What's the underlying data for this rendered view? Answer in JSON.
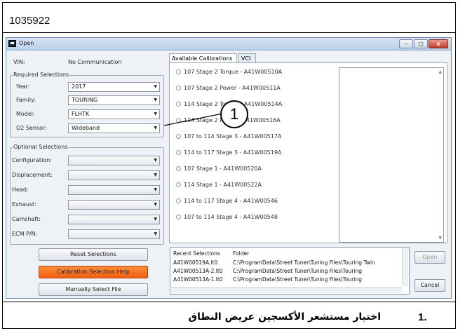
{
  "document": {
    "id": "1035922",
    "callout_number": "1",
    "caption_number": "1.",
    "caption_text": "اختيار مستشعر الأكسجين عريض النطاق"
  },
  "window": {
    "title": "Open",
    "controls": {
      "minimize": "–",
      "maximize": "□",
      "close": "x"
    }
  },
  "vin": {
    "label": "VIN:",
    "value": "No Communication"
  },
  "required_selections": {
    "caption": "Required Selections",
    "fields": [
      {
        "label": "Year:",
        "value": "2017"
      },
      {
        "label": "Family:",
        "value": "TOURING"
      },
      {
        "label": "Model:",
        "value": "FLHTK"
      },
      {
        "label": "O2 Sensor:",
        "value": "Wideband"
      }
    ]
  },
  "optional_selections": {
    "caption": "Optional Selections",
    "fields": [
      {
        "label": "Configuration:",
        "value": ""
      },
      {
        "label": "Displacement:",
        "value": ""
      },
      {
        "label": "Head:",
        "value": ""
      },
      {
        "label": "Exhaust:",
        "value": ""
      },
      {
        "label": "Camshaft:",
        "value": ""
      },
      {
        "label": "ECM P/N:",
        "value": ""
      }
    ]
  },
  "buttons": {
    "reset": "Reset Selections",
    "help": "Calibration Selection Help",
    "manual": "Manually Select File",
    "open": "Open",
    "cancel": "Cancel"
  },
  "tabs": [
    {
      "label": "Available Calibrations"
    },
    {
      "label": "VCI"
    }
  ],
  "calibrations": [
    "107 Stage 2 Torque - A41W00510A",
    "107 Stage 2 Power - A41W00511A",
    "114 Stage 2 Torque - A41W00514A",
    "114 Stage 2 Power - A41W00516A",
    "107 to 114 Stage 3 - A41W00517A",
    "114 to 117 Stage 3 - A41W00519A",
    "107 Stage 1 - A41W00520A",
    "114 Stage 1 - A41W00522A",
    "114 to 117 Stage 4 - A41W00546",
    "107 to 114 Stage 4 - A41W00548"
  ],
  "recent": {
    "headers": {
      "name": "Recent Selections",
      "folder": "Folder"
    },
    "rows": [
      {
        "name": "A41W00519A.lt0",
        "folder": "C:\\ProgramData\\Street Tuner\\Tuning Files\\Touring Twin"
      },
      {
        "name": "A41W00513A-2.lt0",
        "folder": "C:\\ProgramData\\Street Tuner\\Tuning Files\\Touring"
      },
      {
        "name": "A41W00513A-1.lt0",
        "folder": "C:\\ProgramData\\Street Tuner\\Tuning Files\\Touring"
      }
    ]
  },
  "colors": {
    "help_button": "#f06010",
    "window_border": "#6f8fb5"
  }
}
